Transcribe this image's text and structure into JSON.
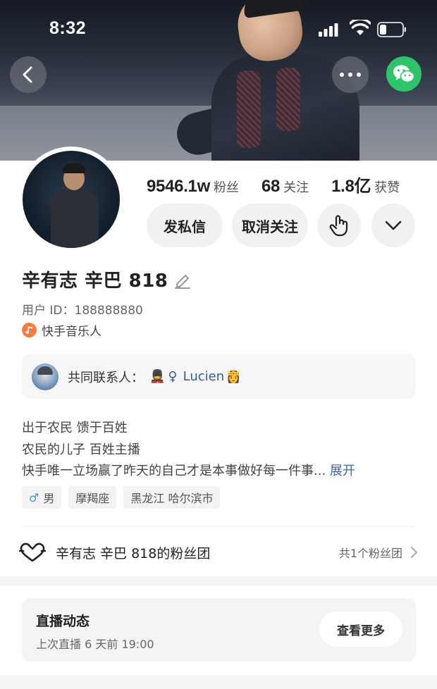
{
  "status_bar": {
    "time": "8:32"
  },
  "stats": [
    {
      "value": "9546.1w",
      "label": "粉丝"
    },
    {
      "value": "68",
      "label": "关注"
    },
    {
      "value": "1.8亿",
      "label": "获赞"
    }
  ],
  "actions": {
    "message": "发私信",
    "unfollow": "取消关注"
  },
  "profile": {
    "name": "辛有志 辛巴 818",
    "user_id": "用户 ID：188888880",
    "badge": "快手音乐人"
  },
  "mutual": {
    "label": "共同联系人：",
    "guard_emoji": "💂",
    "female_symbol": "♀",
    "name": "Lucien",
    "crown_emoji": "👸"
  },
  "bio": {
    "lines": [
      "出于农民 馈于百姓",
      "农民的儿子  百姓主播",
      "快手唯一立场赢了昨天的自己才是本事做好每一件事..."
    ],
    "expand": " 展开"
  },
  "tags": {
    "gender": "男",
    "gender_icon": "♂",
    "zodiac": "摩羯座",
    "location": "黑龙江 哈尔滨市"
  },
  "fan_group": {
    "title": "辛有志 辛巴 818的粉丝团",
    "count": "共1个粉丝团"
  },
  "live": {
    "title": "直播动态",
    "subtitle": "上次直播 6 天前 19:00",
    "more": "查看更多"
  },
  "colors": {
    "wechat": "#2fc46b",
    "link": "#3e67a5",
    "music_badge": "#ff7a3d"
  }
}
